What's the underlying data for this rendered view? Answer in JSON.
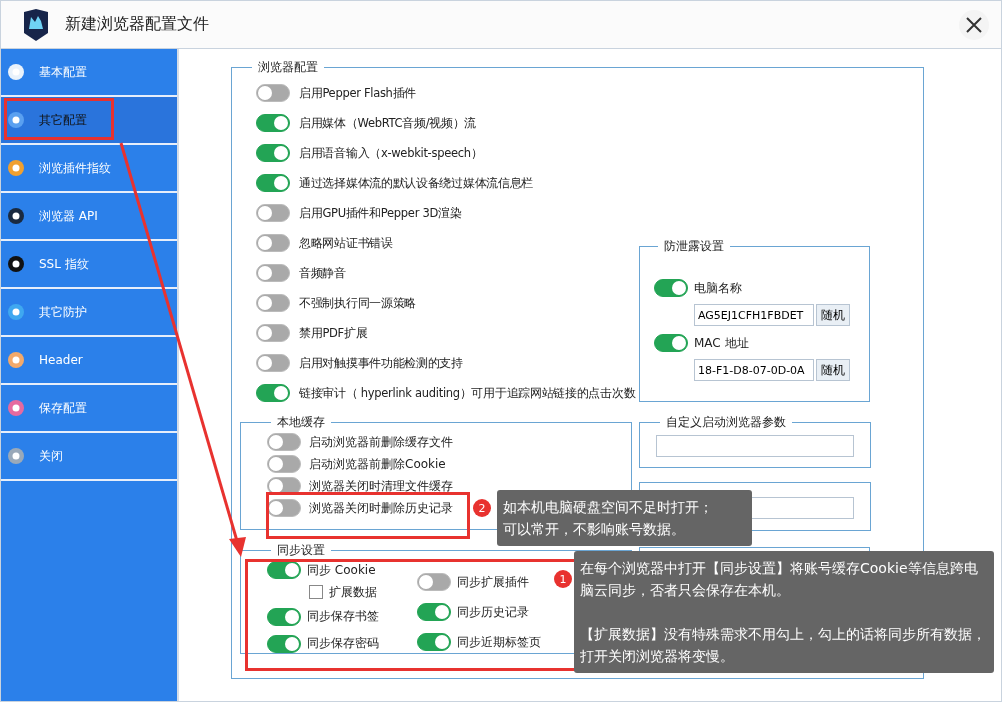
{
  "window": {
    "title": "新建浏览器配置文件"
  },
  "sidebar": {
    "items": [
      {
        "label": "基本配置",
        "selected": false
      },
      {
        "label": "其它配置",
        "selected": true
      },
      {
        "label": "浏览插件指纹",
        "selected": false
      },
      {
        "label": "浏览器 API",
        "selected": false
      },
      {
        "label": "SSL 指纹",
        "selected": false
      },
      {
        "label": "其它防护",
        "selected": false
      },
      {
        "label": "Header",
        "selected": false
      },
      {
        "label": "保存配置",
        "selected": false
      },
      {
        "label": "关闭",
        "selected": false
      }
    ]
  },
  "browser_config": {
    "title": "浏览器配置",
    "toggles": [
      {
        "label": "启用Pepper Flash插件",
        "on": false
      },
      {
        "label": "启用媒体（WebRTC音频/视频）流",
        "on": true
      },
      {
        "label": "启用语音输入（x-webkit-speech）",
        "on": true
      },
      {
        "label": "通过选择媒体流的默认设备绕过媒体流信息栏",
        "on": true
      },
      {
        "label": "启用GPU插件和Pepper 3D渲染",
        "on": false
      },
      {
        "label": "忽略网站证书错误",
        "on": false
      },
      {
        "label": "音频静音",
        "on": false
      },
      {
        "label": "不强制执行同一源策略",
        "on": false
      },
      {
        "label": "禁用PDF扩展",
        "on": false
      },
      {
        "label": "启用对触摸事件功能检测的支持",
        "on": false
      },
      {
        "label": "链接审计（ hyperlink auditing）可用于追踪网站链接的点击次数",
        "on": true
      }
    ]
  },
  "leak_protection": {
    "title": "防泄露设置",
    "items": [
      {
        "label": "电脑名称",
        "on": true,
        "value": "AG5EJ1CFH1FBDET",
        "button": "随机"
      },
      {
        "label": "MAC 地址",
        "on": true,
        "value": "18-F1-D8-07-0D-0A",
        "button": "随机"
      }
    ]
  },
  "local_cache": {
    "title": "本地缓存",
    "toggles": [
      {
        "label": "启动浏览器前删除缓存文件",
        "on": false
      },
      {
        "label": "启动浏览器前删除Cookie",
        "on": false
      },
      {
        "label": "浏览器关闭时清理文件缓存",
        "on": false
      },
      {
        "label": "浏览器关闭时删除历史记录",
        "on": false
      }
    ]
  },
  "custom_args": {
    "title": "自定义启动浏览器参数"
  },
  "sync": {
    "title": "同步设置",
    "columns": [
      [
        {
          "kind": "toggle",
          "label": "同步 Cookie",
          "on": true
        },
        {
          "kind": "checkbox",
          "label": "扩展数据",
          "on": false
        },
        {
          "kind": "toggle",
          "label": "同步保存书签",
          "on": true
        },
        {
          "kind": "toggle",
          "label": "同步保存密码",
          "on": true
        }
      ],
      [
        {
          "kind": "toggle",
          "label": "同步扩展插件",
          "on": false
        },
        {
          "kind": "toggle",
          "label": "同步历史记录",
          "on": true
        },
        {
          "kind": "toggle",
          "label": "同步近期标签页",
          "on": true
        }
      ]
    ]
  },
  "annotations": {
    "tooltips": [
      {
        "number": "2",
        "paragraphs": [
          [
            "如本机电脑硬盘空间不足时打开；",
            "可以常开，不影响账号数据。"
          ]
        ]
      },
      {
        "number": "1",
        "paragraphs": [
          [
            "在每个浏览器中打开【同步设置】将账号缓存Cookie等信息跨电脑云同步，否者只会保存在本机。"
          ],
          [
            "【扩展数据】没有特殊需求不用勾上，勾上的话将同步所有数据，打开关闭浏览器将变慢。"
          ]
        ]
      }
    ]
  }
}
